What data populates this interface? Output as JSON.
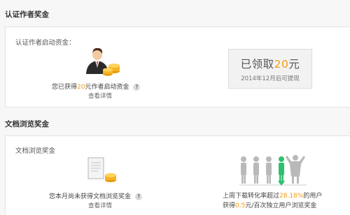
{
  "section1": {
    "title": "认证作者奖金",
    "label": "认证作者启动资金：",
    "notice_prefix": "您已获得",
    "notice_amount": "20",
    "notice_suffix": "元作者启动资金",
    "help": "?",
    "detail_link": "查看详情",
    "claim": {
      "prefix": "已领取",
      "amount": "20",
      "suffix": "元",
      "sub": "2014年12月后可提现"
    }
  },
  "section2": {
    "title": "文档浏览奖金",
    "label": "文档浏览奖金",
    "notice": "您本月尚未获得文档浏览奖金",
    "help": "?",
    "detail_link": "查看详情",
    "weekly_prefix": "上周下载转化率超过",
    "weekly_rate": "28.18%",
    "weekly_suffix": "的用户",
    "bonus_prefix": "获得",
    "bonus_amount": "0.5",
    "bonus_suffix": "元/百次独立用户浏览奖金"
  },
  "colors": {
    "accent": "#f39c12",
    "highlight_green": "#2fbf71",
    "panel_border": "#e3e3e3"
  }
}
